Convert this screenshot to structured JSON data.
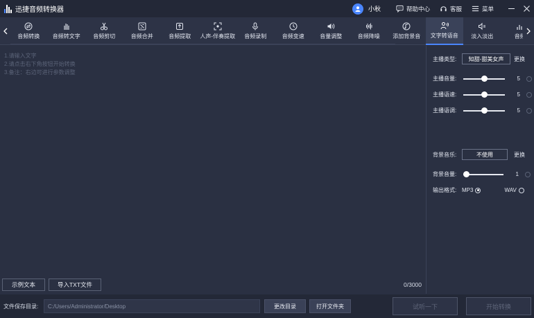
{
  "app": {
    "title": "迅捷音频转换器",
    "username": "小秋",
    "help_label": "帮助中心",
    "service_label": "客服",
    "menu_label": "菜单"
  },
  "toolbar": {
    "tools": [
      {
        "label": "音频转换",
        "icon": "convert-icon"
      },
      {
        "label": "音频转文字",
        "icon": "hand-icon"
      },
      {
        "label": "音频剪切",
        "icon": "scissors-icon"
      },
      {
        "label": "音频合并",
        "icon": "merge-icon"
      },
      {
        "label": "音频提取",
        "icon": "upload-icon"
      },
      {
        "label": "人声-伴奏提取",
        "icon": "vocal-separate-icon"
      },
      {
        "label": "音频录制",
        "icon": "microphone-icon"
      },
      {
        "label": "音频变速",
        "icon": "clock-icon"
      },
      {
        "label": "音量调整",
        "icon": "volume-icon"
      },
      {
        "label": "音频降噪",
        "icon": "waveform-icon"
      },
      {
        "label": "添加背景音",
        "icon": "music-disc-icon"
      },
      {
        "label": "文字转语音",
        "icon": "text-to-speech-icon",
        "active": true
      },
      {
        "label": "淡入淡出",
        "icon": "fade-icon"
      },
      {
        "label": "音频",
        "icon": "bars-icon"
      }
    ]
  },
  "editor": {
    "hints": [
      "1.请输入文字",
      "2.请点击右下角按钮开始转换",
      "3.备注：右边可进行参数调整"
    ],
    "sample_button": "示例文本",
    "import_button": "导入TXT文件",
    "counter": "0/3000"
  },
  "panel": {
    "voice_type_label": "主播类型:",
    "voice_type_value": "知甜-甜美女声",
    "change_label": "更换",
    "volume_label": "主播音量:",
    "volume_value": "5",
    "volume_level": 0.5,
    "speed_label": "主播语速:",
    "speed_value": "5",
    "speed_level": 0.5,
    "pitch_label": "主播语调:",
    "pitch_value": "5",
    "pitch_level": 0.5,
    "bg_music_label": "背景音乐:",
    "bg_music_value": "不使用",
    "bg_change_label": "更换",
    "bg_volume_label": "背景音量:",
    "bg_volume_value": "1",
    "bg_volume_level": 0.0,
    "format_label": "输出格式:",
    "format_mp3": "MP3",
    "format_wav": "WAV",
    "selected_format": "MP3"
  },
  "bottom": {
    "save_dir_label": "文件保存目录:",
    "save_path": "C:/Users/Administrator/Desktop",
    "change_dir_button": "更改目录",
    "open_folder_button": "打开文件夹",
    "trial_button": "试听一下",
    "start_button": "开始转换"
  },
  "colors": {
    "accent": "#4a86ff",
    "background": "#2a3042",
    "titlebar": "#232837"
  }
}
